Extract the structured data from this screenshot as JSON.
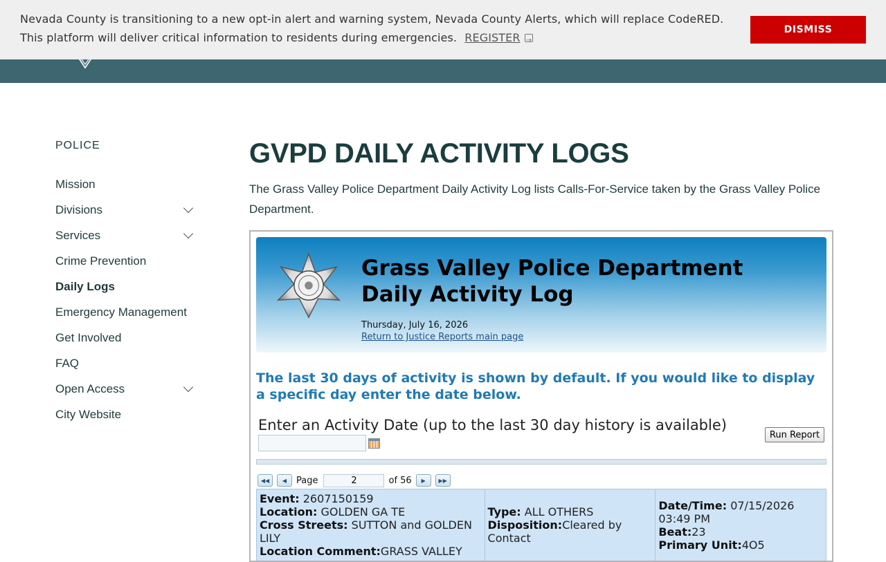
{
  "alert": {
    "message": "Nevada County is transitioning to a new opt-in alert and warning system, Nevada County Alerts, which will replace CodeRED. This platform will deliver critical information to residents during emergencies.",
    "link_label": "REGISTER",
    "dismiss_label": "DISMISS"
  },
  "sidebar": {
    "heading": "POLICE",
    "items": [
      {
        "label": "Mission"
      },
      {
        "label": "Divisions"
      },
      {
        "label": "Services"
      },
      {
        "label": "Crime Prevention"
      },
      {
        "label": "Daily Logs"
      },
      {
        "label": "Emergency Management"
      },
      {
        "label": "Get Involved"
      },
      {
        "label": "FAQ"
      },
      {
        "label": "Open Access"
      },
      {
        "label": "City Website"
      }
    ]
  },
  "main": {
    "title": "GVPD DAILY ACTIVITY LOGS",
    "intro": "The Grass Valley Police Department Daily Activity Log lists Calls-For-Service taken by the Grass Valley Police Department."
  },
  "report": {
    "title_line1": "Grass Valley Police Department",
    "title_line2": "Daily Activity Log",
    "date": "Thursday, July 16, 2026",
    "return_link": "Return to Justice Reports main page",
    "notice": "The last 30 days of activity is shown by default. If you would like to display a specific day enter the date below.",
    "date_label": "Enter an Activity Date (up to the last 30 day history is available)",
    "date_value": "",
    "run_button": "Run Report",
    "pager": {
      "page_label": "Page",
      "page_value": "2",
      "of_label": "of 56"
    },
    "record": {
      "event_label": "Event:",
      "event_value": "2607150159",
      "location_label": "Location:",
      "location_value": "GOLDEN GA TE",
      "cross_label": "Cross Streets:",
      "cross_value": "SUTTON and GOLDEN LILY",
      "comment_label": "Location Comment:",
      "comment_value": "GRASS VALLEY",
      "type_label": "Type:",
      "type_value": "ALL OTHERS",
      "disposition_label": "Disposition:",
      "disposition_value": "Cleared by Contact",
      "datetime_label": "Date/Time:",
      "datetime_value": "07/15/2026 03:49 PM",
      "beat_label": "Beat:",
      "beat_value": "23",
      "unit_label": "Primary Unit:",
      "unit_value": "4O5"
    }
  },
  "colors": {
    "header_teal": "#3d6670",
    "dismiss_red": "#cc0000",
    "notice_blue": "#1f7ab5",
    "record_bg": "#cfe4f7"
  }
}
